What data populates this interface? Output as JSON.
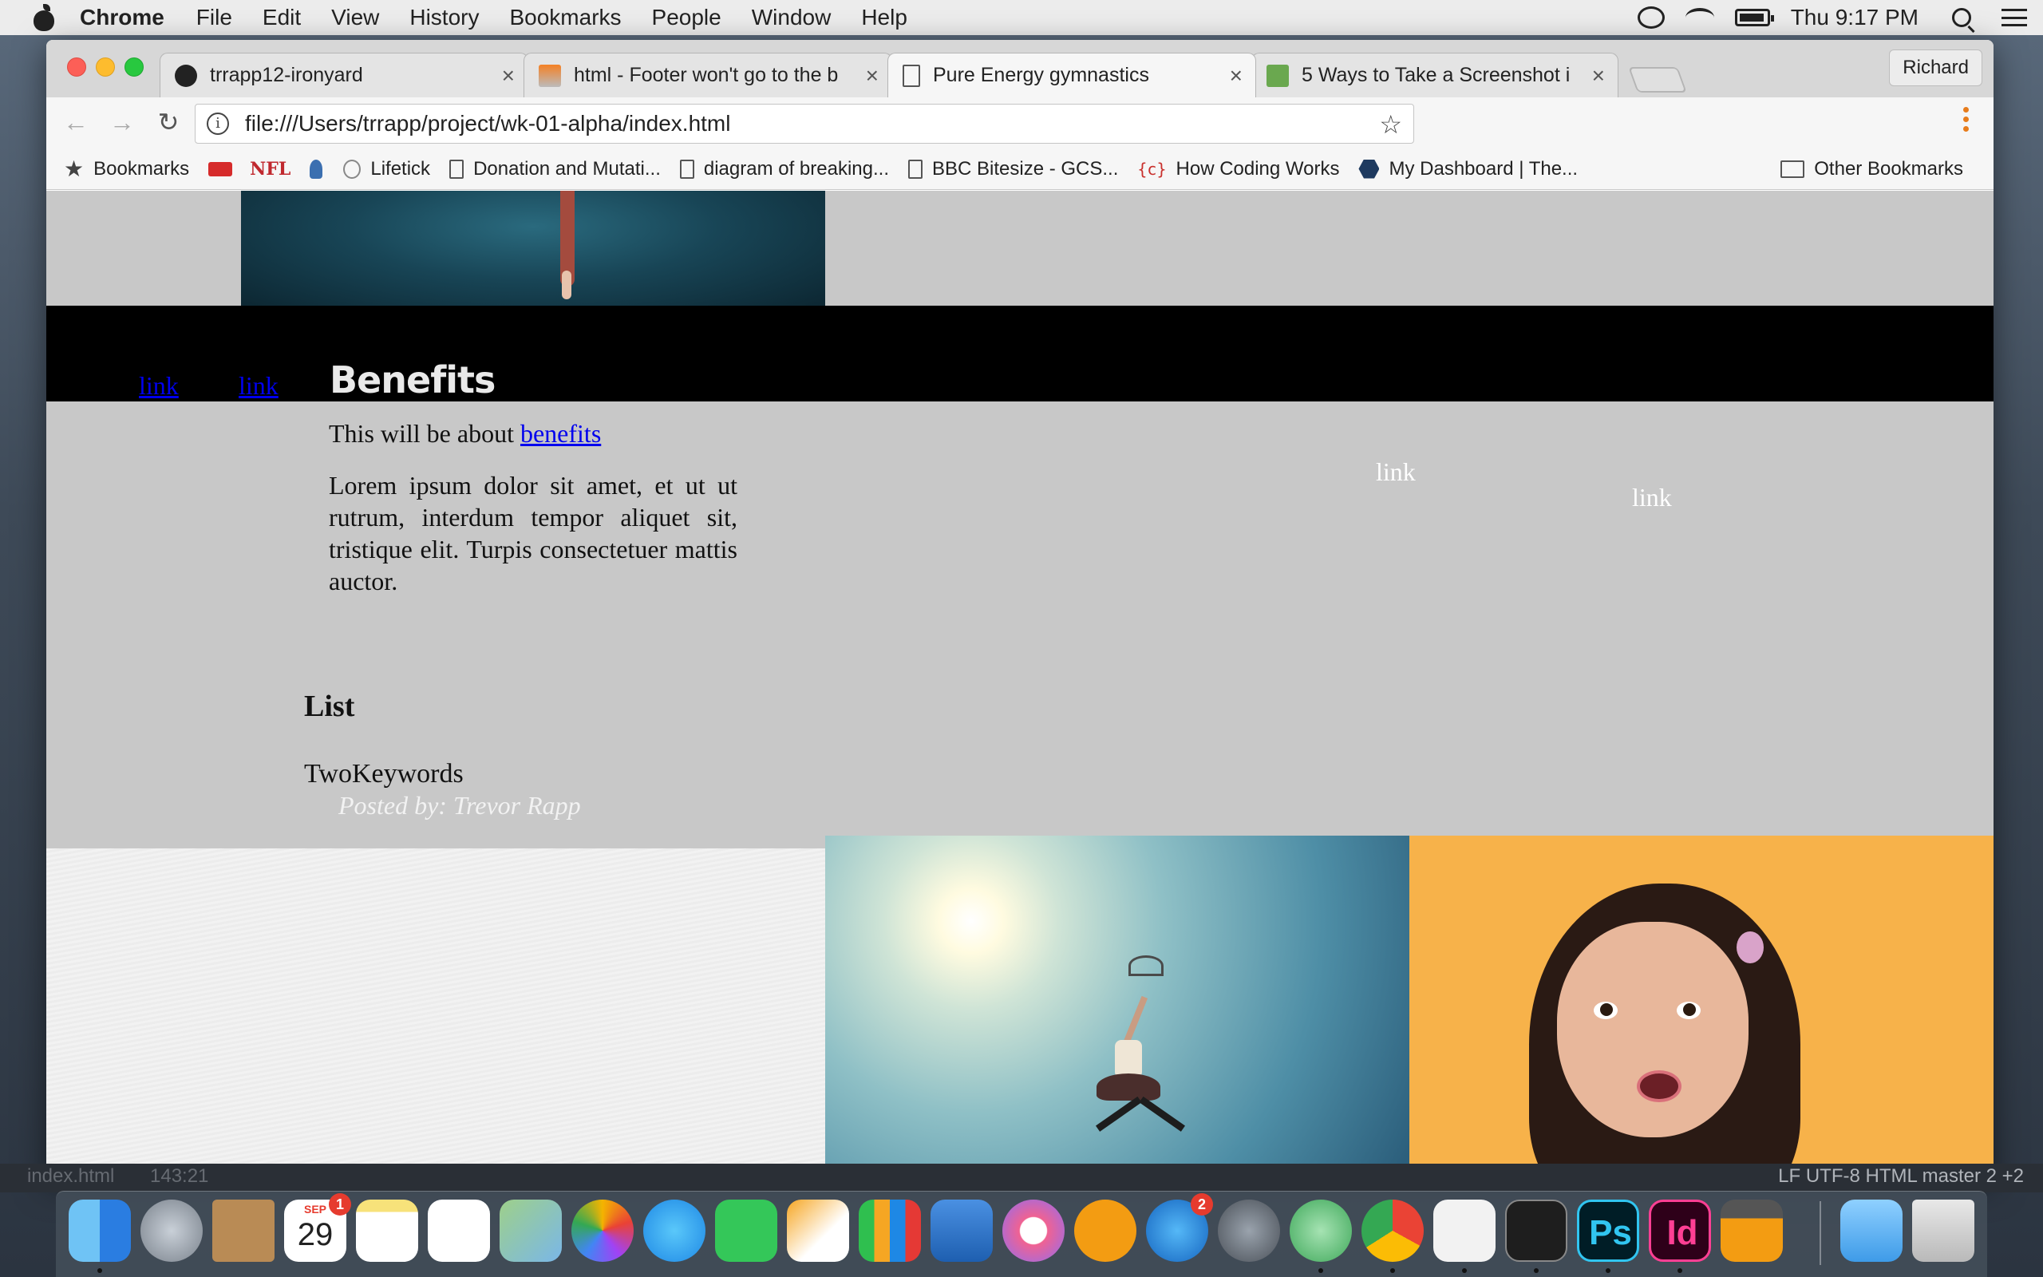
{
  "menubar": {
    "app_name": "Chrome",
    "menus": [
      "File",
      "Edit",
      "View",
      "History",
      "Bookmarks",
      "People",
      "Window",
      "Help"
    ],
    "clock": "Thu 9:17 PM",
    "icons": [
      "creative-cloud-icon",
      "wifi-icon",
      "battery-icon",
      "spotlight-icon",
      "notification-center-icon"
    ]
  },
  "browser": {
    "tabs": [
      {
        "title": "trrapp12-ironyard",
        "icon": "github-icon",
        "close": "×"
      },
      {
        "title": "html - Footer won't go to the b",
        "icon": "stackoverflow-icon",
        "close": "×"
      },
      {
        "title": "Pure Energy gymnastics",
        "icon": "document-icon",
        "close": "×",
        "active": true
      },
      {
        "title": "5 Ways to Take a Screenshot i",
        "icon": "wikihow-icon",
        "close": "×"
      }
    ],
    "profile_name": "Richard",
    "nav": {
      "back": "←",
      "forward": "→",
      "reload": "↻"
    },
    "url": "file:///Users/trrapp/project/wk-01-alpha/index.html",
    "bookmarks_bar": [
      {
        "label": "Bookmarks",
        "icon": "star-icon"
      },
      {
        "label": "",
        "icon": "adp-icon"
      },
      {
        "label": "NFL",
        "icon": "nfl-icon"
      },
      {
        "label": "",
        "icon": "person-icon"
      },
      {
        "label": "Lifetick",
        "icon": "lifetick-icon"
      },
      {
        "label": "Donation and Mutati...",
        "icon": "document-icon"
      },
      {
        "label": "diagram of breaking...",
        "icon": "document-icon"
      },
      {
        "label": "BBC Bitesize - GCS...",
        "icon": "document-icon"
      },
      {
        "label": "How Coding Works",
        "icon": "code-icon"
      },
      {
        "label": "My Dashboard | The...",
        "icon": "hexagon-icon"
      }
    ],
    "other_bookmarks": "Other Bookmarks"
  },
  "page": {
    "nav_links": [
      "link",
      "link"
    ],
    "section_heading": "Benefits",
    "intro_text": "This will be about ",
    "intro_link": "benefits",
    "lorem": "Lorem ipsum dolor sit amet, et ut ut rutrum, interdum tempor aliquet sit, tristique elit. Turpis consectetuer mattis auctor.",
    "floating_links": [
      "link",
      "link"
    ],
    "list_heading": "List",
    "keywords": "TwoKeywords",
    "posted_by": "Posted by: Trevor Rapp"
  },
  "editor_status": {
    "filename": "index.html",
    "cursor": "143:21",
    "right": "LF   UTF-8   HTML   master   2   +2"
  },
  "dock": {
    "apps": [
      "finder",
      "launchpad",
      "contacts",
      "calendar",
      "notes",
      "reminders",
      "maps",
      "photos",
      "messages",
      "facetime",
      "pages",
      "numbers",
      "keynote",
      "itunes",
      "ibooks",
      "app-store",
      "system-preferences",
      "atom",
      "chrome",
      "slack",
      "terminal",
      "photoshop",
      "indesign",
      "calculator",
      "downloads",
      "trash"
    ],
    "calendar_month": "SEP",
    "calendar_day": "29",
    "calendar_badge": "1",
    "appstore_badge": "2",
    "photoshop_label": "Ps",
    "indesign_label": "Id"
  }
}
